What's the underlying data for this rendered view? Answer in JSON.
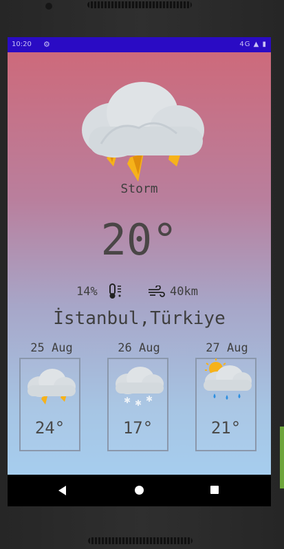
{
  "status_bar": {
    "time": "10:20",
    "right_icons": "4G ▲ ▮"
  },
  "current": {
    "condition": "Storm",
    "temperature": "20°",
    "humidity": "14%",
    "wind": "40km",
    "location": "İstanbul,Türkiye",
    "icon": "storm-cloud-icon"
  },
  "forecast": [
    {
      "date": "25 Aug",
      "temp": "24°",
      "icon": "storm-cloud-icon"
    },
    {
      "date": "26 Aug",
      "temp": "17°",
      "icon": "snow-cloud-icon"
    },
    {
      "date": "27 Aug",
      "temp": "21°",
      "icon": "sun-rain-cloud-icon"
    }
  ],
  "colors": {
    "status_bar": "#2a0bc4",
    "gradient_top": "#cd6a7b",
    "gradient_bottom": "#a6cdee",
    "text": "#3f3f3f"
  }
}
